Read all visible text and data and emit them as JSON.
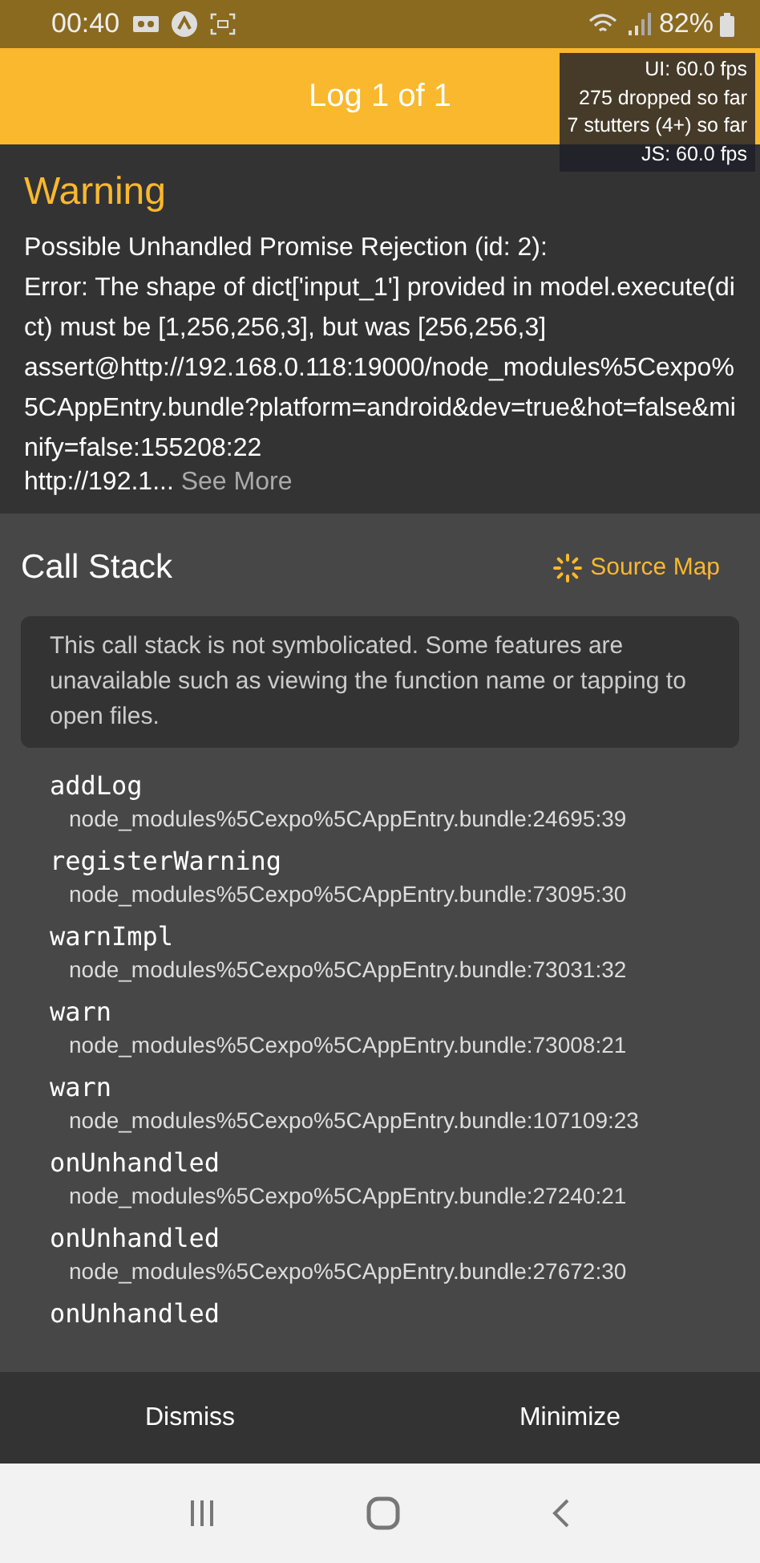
{
  "status_bar": {
    "time": "00:40",
    "battery": "82%"
  },
  "header": {
    "title": "Log 1 of 1"
  },
  "perf_monitor": [
    "UI: 60.0 fps",
    "275 dropped so far",
    "7 stutters (4+) so far",
    "JS: 60.0 fps"
  ],
  "warning": {
    "title": "Warning",
    "message": "Possible Unhandled Promise Rejection (id: 2):\nError: The shape of dict['input_1'] provided in model.execute(dict) must be [1,256,256,3], but was [256,256,3]\nassert@http://192.168.0.118:19000/node_modules%5Cexpo%5CAppEntry.bundle?platform=android&dev=true&hot=false&minify=false:155208:22",
    "more_prefix": "http://192.1...",
    "more_link": "See More"
  },
  "call_stack": {
    "title": "Call Stack",
    "source_map": "Source Map",
    "notice": "This call stack is not symbolicated. Some features are unavailable such as viewing the function name or tapping to open files.",
    "frames": [
      {
        "name": "addLog",
        "location": "node_modules%5Cexpo%5CAppEntry.bundle:24695:39"
      },
      {
        "name": "registerWarning",
        "location": "node_modules%5Cexpo%5CAppEntry.bundle:73095:30"
      },
      {
        "name": "warnImpl",
        "location": "node_modules%5Cexpo%5CAppEntry.bundle:73031:32"
      },
      {
        "name": "warn",
        "location": "node_modules%5Cexpo%5CAppEntry.bundle:73008:21"
      },
      {
        "name": "warn",
        "location": "node_modules%5Cexpo%5CAppEntry.bundle:107109:23"
      },
      {
        "name": "onUnhandled",
        "location": "node_modules%5Cexpo%5CAppEntry.bundle:27240:21"
      },
      {
        "name": "onUnhandled",
        "location": "node_modules%5Cexpo%5CAppEntry.bundle:27672:30"
      },
      {
        "name": "onUnhandled"
      }
    ]
  },
  "footer_buttons": [
    "Dismiss",
    "Minimize"
  ]
}
